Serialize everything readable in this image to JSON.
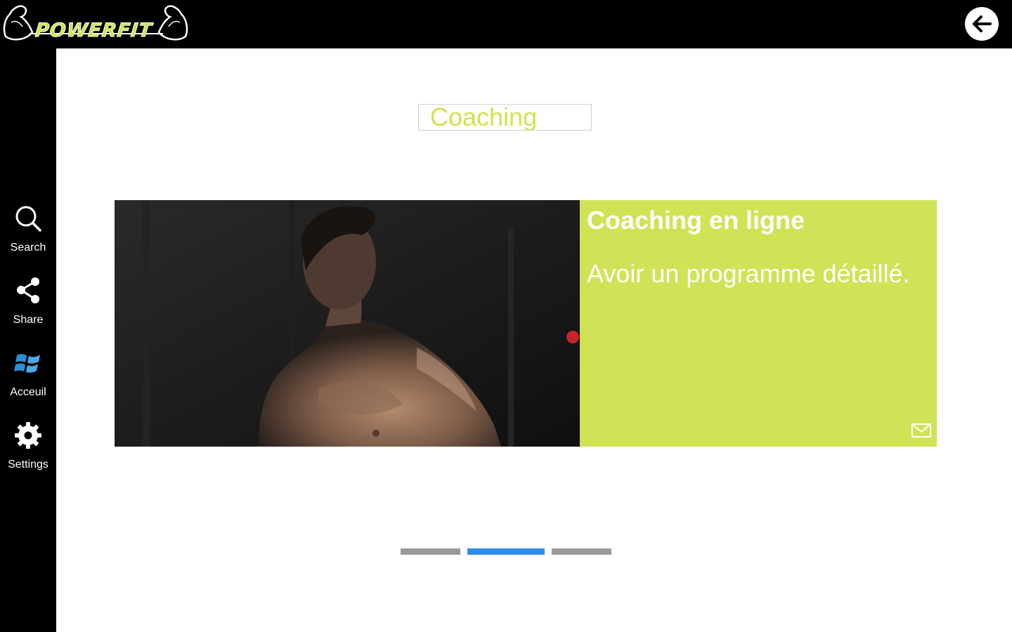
{
  "app": {
    "logo_text": "POWERFIT"
  },
  "header": {
    "back_icon": "arrow-left-icon"
  },
  "sidebar": {
    "items": [
      {
        "label": "Search",
        "icon": "search-icon"
      },
      {
        "label": "Share",
        "icon": "share-icon"
      },
      {
        "label": "Acceuil",
        "icon": "windows-logo-icon"
      },
      {
        "label": "Settings",
        "icon": "gear-icon"
      }
    ]
  },
  "search": {
    "value": "Coaching"
  },
  "card": {
    "title": "Coaching en ligne",
    "description": "Avoir un programme détaillé.",
    "action_icon": "mail-icon"
  },
  "carousel": {
    "count": 3,
    "active_index": 1
  },
  "colors": {
    "brand_lime": "#d0e356",
    "sidebar_bg": "#000000",
    "indicator_active": "#2f8ce8",
    "indicator_inactive": "#999999"
  }
}
